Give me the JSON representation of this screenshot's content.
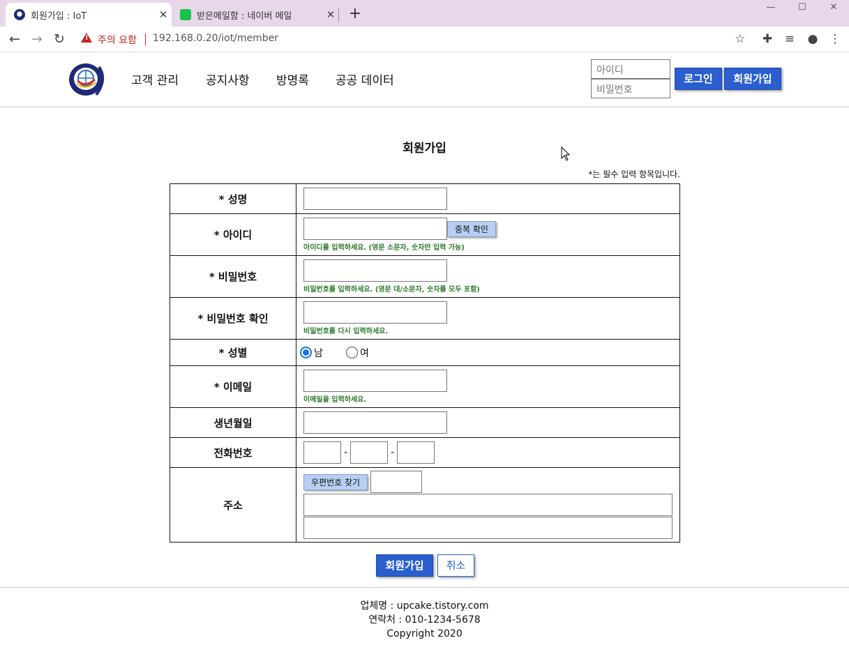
{
  "browser": {
    "tabs": [
      {
        "title": "회원가입 : IoT",
        "active": true
      },
      {
        "title": "받은메일함 : 네이버 메일",
        "active": false
      }
    ],
    "warning_text": "주의 요함",
    "url": "192.168.0.20/iot/member",
    "window_controls": {
      "minimize": "—",
      "maximize": "☐",
      "close": "✕"
    }
  },
  "header": {
    "menu": [
      "고객 관리",
      "공지사항",
      "방명록",
      "공공 데이터"
    ],
    "login": {
      "id_placeholder": "아이디",
      "pw_placeholder": "비밀번호",
      "login_label": "로그인",
      "join_label": "회원가입"
    }
  },
  "main": {
    "title": "회원가입",
    "required_note": "*는 필수 입력 항목입니다.",
    "rows": {
      "name": {
        "label": "* 성명"
      },
      "userid": {
        "label": "* 아이디",
        "check_button": "중복 확인",
        "hint": "아이디를 입력하세요. (영문 소문자, 숫자만 입력 가능)"
      },
      "password": {
        "label": "* 비밀번호",
        "hint": "비밀번호를 입력하세요. (영문 대/소문자, 숫자를 모두 포함)"
      },
      "password_confirm": {
        "label": "* 비밀번호 확인",
        "hint": "비밀번호를 다시 입력하세요."
      },
      "gender": {
        "label": "* 성별",
        "options": [
          "남",
          "여"
        ],
        "selected": "남"
      },
      "email": {
        "label": "* 이메일",
        "hint": "이메일을 입력하세요."
      },
      "birth": {
        "label": "생년월일"
      },
      "phone": {
        "label": "전화번호",
        "separator": "-"
      },
      "address": {
        "label": "주소",
        "postcode_button": "우편번호 찾기"
      }
    },
    "submit_label": "회원가입",
    "cancel_label": "취소"
  },
  "footer": {
    "company": "업체명 : upcake.tistory.com",
    "contact": "연락처 : 010-1234-5678",
    "copyright": "Copyright 2020"
  },
  "colors": {
    "accent": "#2b5fd0",
    "hint_green": "#2c7a2c",
    "warning_red": "#c5221f",
    "tabbar": "#e7d7e9"
  }
}
